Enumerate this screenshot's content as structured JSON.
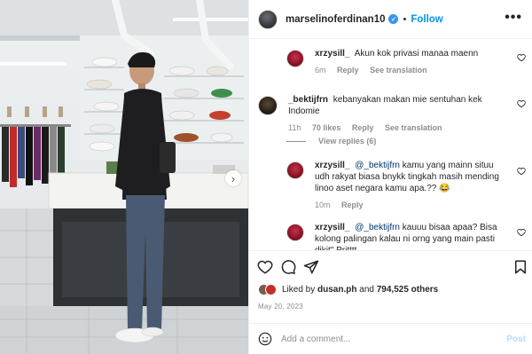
{
  "post": {
    "username": "marselinoferdinan10",
    "follow_label": "Follow",
    "more_label": "•••",
    "carousel_next_label": "›"
  },
  "comments": [
    {
      "user": "xrzysill_",
      "text": "Akun kok privasi manaa maenn",
      "time": "6m",
      "reply_label": "Reply",
      "translation_label": "See translation"
    },
    {
      "user": "_bektijfrn",
      "text": "kebanyakan makan mie sentuhan kek Indomie",
      "time": "11h",
      "likes": "70 likes",
      "reply_label": "Reply",
      "translation_label": "See translation",
      "view_replies": "View replies (6)"
    },
    {
      "user": "xrzysill_",
      "mention": "@_bektijfrn",
      "text": "kamu yang mainn situu udh rakyat biasa bnykk tingkah masih mending linoo aset negara kamu apa.?? 😂",
      "time": "10m",
      "reply_label": "Reply"
    },
    {
      "user": "xrzysill_",
      "mention": "@_bektijfrn",
      "text": "kauuu bisaa apaa? Bisa kolong palingan kalau ni orng yang main pasti dikit\" Pritttt"
    }
  ],
  "likes": {
    "prefix": "Liked by",
    "user": "dusan.ph",
    "joiner": "and",
    "count": "794,525 others"
  },
  "date": "May 20, 2023",
  "add_comment": {
    "placeholder": "Add a comment...",
    "post_label": "Post"
  },
  "icons": [
    "heart-icon",
    "comment-icon",
    "share-icon",
    "bookmark-icon",
    "emoji-icon",
    "verified-icon",
    "more-icon"
  ],
  "colors": {
    "accent": "#0095f6",
    "mention": "#00376b",
    "muted": "#8e8e8e",
    "text": "#262626"
  }
}
